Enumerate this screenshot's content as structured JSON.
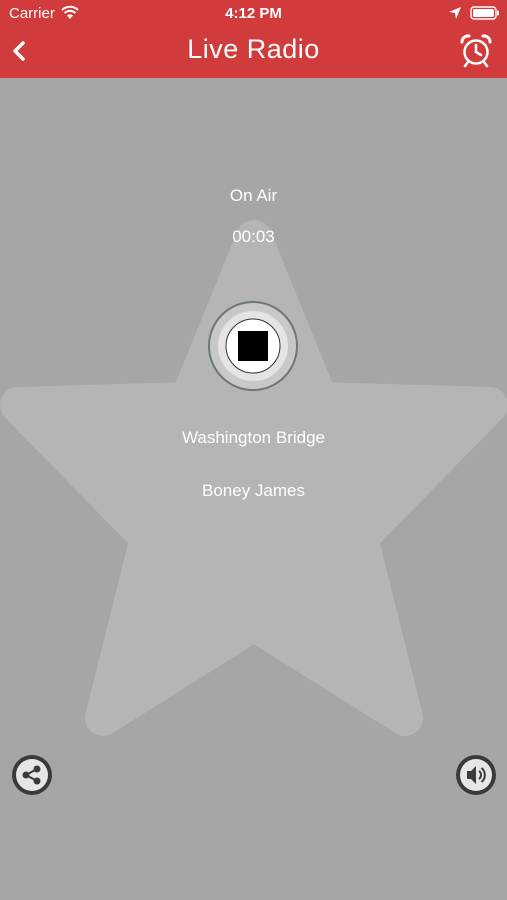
{
  "status_bar": {
    "carrier": "Carrier",
    "time": "4:12 PM",
    "icons": [
      "wifi-icon",
      "location-arrow-icon",
      "battery-icon"
    ]
  },
  "nav": {
    "title": "Live Radio",
    "back_icon": "chevron-left-icon",
    "alarm_icon": "alarm-clock-icon"
  },
  "player": {
    "status": "On Air",
    "elapsed": "00:03",
    "control_icon": "stop-icon",
    "track_title": "Washington Bridge",
    "artist": "Boney James"
  },
  "footer": {
    "share_icon": "share-icon",
    "volume_icon": "volume-icon"
  },
  "colors": {
    "header": "#d13b3b",
    "background": "#a6a6a6",
    "star": "#b5b5b5",
    "text": "#ffffff"
  }
}
